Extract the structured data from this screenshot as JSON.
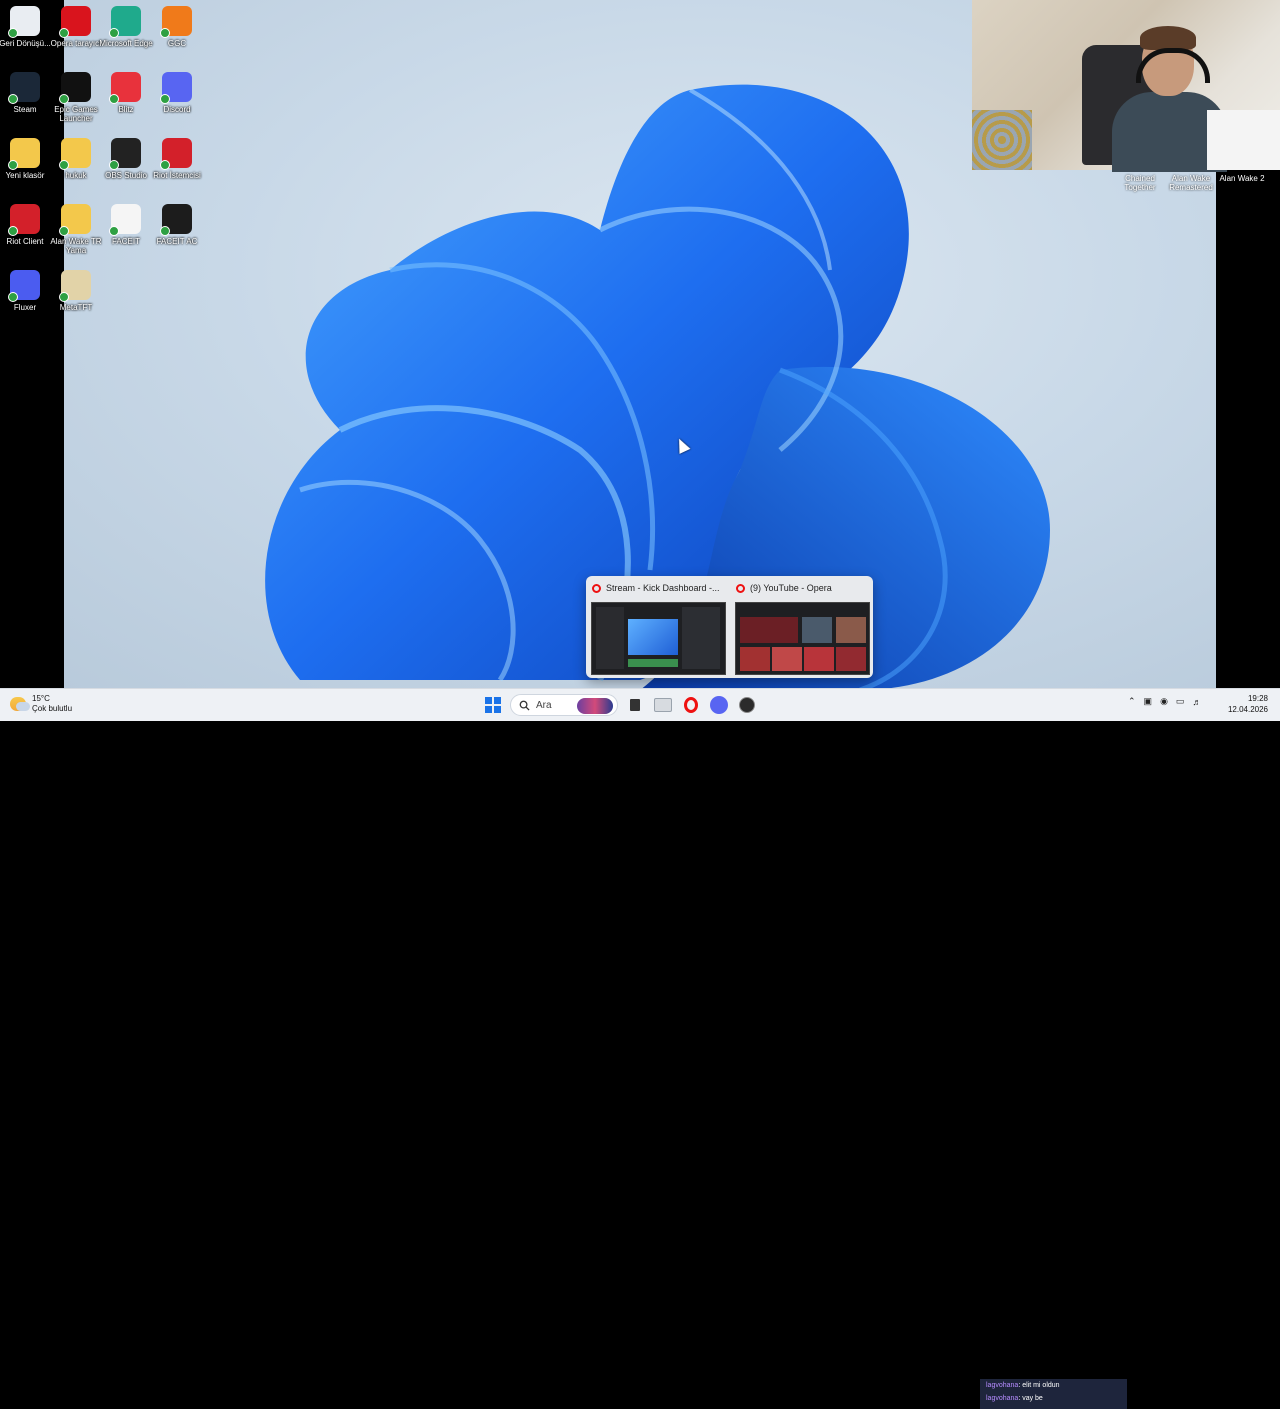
{
  "desktop_icons": [
    {
      "label": "Geri Dönüşü...",
      "icon": "recycle-bin-icon",
      "color": "#e9edf2"
    },
    {
      "label": "Opera tarayıcı",
      "icon": "opera-icon",
      "color": "#d9141d"
    },
    {
      "label": "Microsoft Edge",
      "icon": "edge-icon",
      "color": "#1faa8c"
    },
    {
      "label": "GGC",
      "icon": "ggc-icon",
      "color": "#f07a1a"
    },
    {
      "label": "Steam",
      "icon": "steam-icon",
      "color": "#1b2838"
    },
    {
      "label": "Epic Games Launcher",
      "icon": "epic-games-icon",
      "color": "#111111"
    },
    {
      "label": "Blitz",
      "icon": "blitz-icon",
      "color": "#e8323c"
    },
    {
      "label": "Discord",
      "icon": "discord-icon",
      "color": "#5865f2"
    },
    {
      "label": "Yeni klasör",
      "icon": "folder-icon",
      "color": "#f3c84b"
    },
    {
      "label": "hukuk",
      "icon": "folder-icon",
      "color": "#f3c84b"
    },
    {
      "label": "OBS Studio",
      "icon": "obs-icon",
      "color": "#222222"
    },
    {
      "label": "Riot İstemcisi",
      "icon": "riot-icon",
      "color": "#d3202a"
    },
    {
      "label": "Riot Client",
      "icon": "riot-icon",
      "color": "#d3202a"
    },
    {
      "label": "Alan Wake TR Yama",
      "icon": "folder-icon",
      "color": "#f3c84b"
    },
    {
      "label": "FACEIT",
      "icon": "file-icon",
      "color": "#f5f5f5"
    },
    {
      "label": "FACEIT AC",
      "icon": "faceit-ac-icon",
      "color": "#1c1c1c"
    },
    {
      "label": "Fluxer",
      "icon": "fluxer-icon",
      "color": "#4b5cf0"
    },
    {
      "label": "MetaTFT",
      "icon": "metatft-icon",
      "color": "#e2d3a8"
    }
  ],
  "webcam_tiles": [
    "Chained Together",
    "Alan Wake Remastered",
    "Alan Wake 2"
  ],
  "preview_popup": {
    "cards": [
      {
        "title": "Stream - Kick Dashboard -..."
      },
      {
        "title": "(9) YouTube - Opera"
      }
    ]
  },
  "taskbar": {
    "weather_temp": "15°C",
    "weather_desc": "Çok bulutlu",
    "search_placeholder": "Ara",
    "time": "19:28",
    "date": "12.04.2026"
  },
  "chat_overlay": {
    "messages": [
      {
        "user": "lagvohana",
        "text": ": elit mi oldun"
      },
      {
        "user": "lagvohana",
        "text": ": vay be"
      }
    ]
  },
  "colors": {
    "accent": "#1a73e8",
    "opera_red": "#e11111"
  }
}
